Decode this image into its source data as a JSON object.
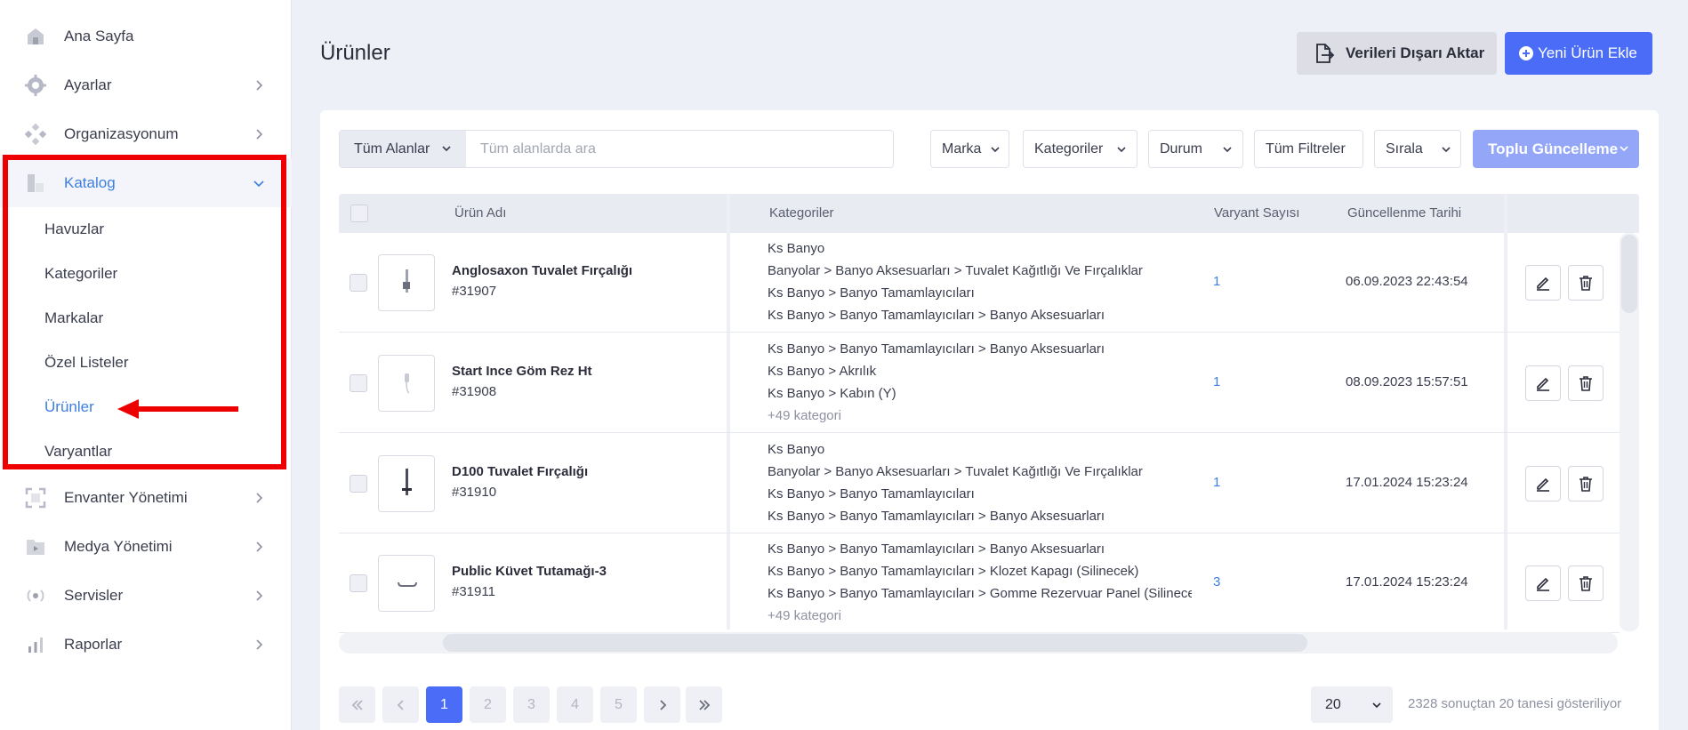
{
  "sidebar": {
    "items": [
      {
        "label": "Ana Sayfa",
        "icon": "home-icon"
      },
      {
        "label": "Ayarlar",
        "icon": "gear-icon"
      },
      {
        "label": "Organizasyonum",
        "icon": "organization-icon"
      },
      {
        "label": "Katalog",
        "icon": "catalog-icon"
      },
      {
        "label": "Envanter Yönetimi",
        "icon": "inventory-icon"
      },
      {
        "label": "Medya Yönetimi",
        "icon": "media-folder-icon"
      },
      {
        "label": "Servisler",
        "icon": "broadcast-icon"
      },
      {
        "label": "Raporlar",
        "icon": "bar-chart-icon"
      }
    ],
    "catalog_sub": [
      {
        "label": "Havuzlar"
      },
      {
        "label": "Kategoriler"
      },
      {
        "label": "Markalar"
      },
      {
        "label": "Özel Listeler"
      },
      {
        "label": "Ürünler"
      },
      {
        "label": "Varyantlar"
      }
    ],
    "active_section": "Katalog",
    "current_page": "Ürünler"
  },
  "header": {
    "title": "Ürünler",
    "export_label": "Verileri Dışarı Aktar",
    "new_label": "Yeni Ürün Ekle"
  },
  "search": {
    "scope": "Tüm Alanlar",
    "placeholder": "Tüm alanlarda ara",
    "value": ""
  },
  "filters": {
    "brand": "Marka",
    "categories": "Kategoriler",
    "status": "Durum",
    "all_filters": "Tüm Filtreler",
    "sort": "Sırala",
    "bulk_update": "Toplu Güncelleme"
  },
  "table": {
    "columns": [
      "Ürün Adı",
      "Kategoriler",
      "Varyant Sayısı",
      "Güncellenme Tarihi"
    ],
    "rows": [
      {
        "name": "Anglosaxon Tuvalet Fırçalığı",
        "id": "#31907",
        "categories": [
          "Ks Banyo",
          "Banyolar > Banyo Aksesuarları > Tuvalet Kağıtlığı Ve Fırçalıklar",
          "Ks Banyo > Banyo Tamamlayıcıları",
          "Ks Banyo > Banyo Tamamlayıcıları > Banyo Aksesuarları"
        ],
        "more": "",
        "variants": "1",
        "updated": "06.09.2023 22:43:54"
      },
      {
        "name": "Start Ince Göm Rez Ht",
        "id": "#31908",
        "categories": [
          "Ks Banyo > Banyo Tamamlayıcıları > Banyo Aksesuarları",
          "Ks Banyo > Akrılık",
          "Ks Banyo > Kabın (Y)"
        ],
        "more": "+49 kategori",
        "variants": "1",
        "updated": "08.09.2023 15:57:51"
      },
      {
        "name": "D100 Tuvalet Fırçalığı",
        "id": "#31910",
        "categories": [
          "Ks Banyo",
          "Banyolar > Banyo Aksesuarları > Tuvalet Kağıtlığı Ve Fırçalıklar",
          "Ks Banyo > Banyo Tamamlayıcıları",
          "Ks Banyo > Banyo Tamamlayıcıları > Banyo Aksesuarları"
        ],
        "more": "",
        "variants": "1",
        "updated": "17.01.2024 15:23:24"
      },
      {
        "name": "Public Küvet Tutamağı-3",
        "id": "#31911",
        "categories": [
          "Ks Banyo > Banyo Tamamlayıcıları > Banyo Aksesuarları",
          "Ks Banyo > Banyo Tamamlayıcıları > Klozet Kapagı (Silinecek)",
          "Ks Banyo > Banyo Tamamlayıcıları > Gomme Rezervuar Panel (Silinecek)"
        ],
        "more": "+49 kategori",
        "variants": "3",
        "updated": "17.01.2024 15:23:24"
      }
    ]
  },
  "pagination": {
    "pages": [
      "1",
      "2",
      "3",
      "4",
      "5"
    ],
    "current": "1",
    "page_size": "20",
    "info": "2328 sonuçtan 20 tanesi gösteriliyor"
  },
  "colors": {
    "accent": "#4a6cf7",
    "link": "#3d7fe0",
    "annotation": "#ef0000"
  }
}
